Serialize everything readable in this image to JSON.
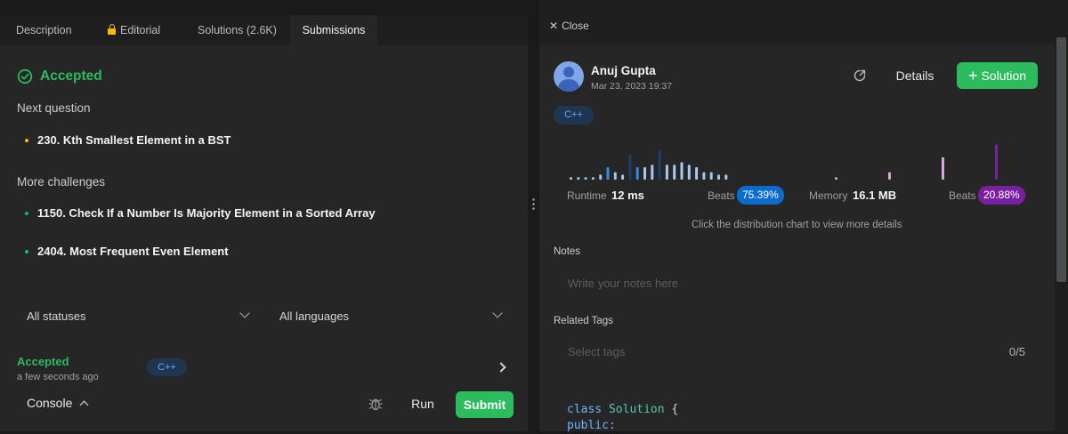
{
  "tabs": {
    "description": "Description",
    "editorial": "Editorial",
    "solutions": "Solutions (2.6K)",
    "submissions": "Submissions"
  },
  "result": {
    "status": "Accepted",
    "next_question_title": "Next question",
    "next_question": "230. Kth Smallest Element in a BST",
    "more_challenges_title": "More challenges",
    "challenges": [
      "1150. Check If a Number Is Majority Element in a Sorted Array",
      "2404. Most Frequent Even Element"
    ]
  },
  "filters": {
    "status": "All statuses",
    "language": "All languages"
  },
  "submission": {
    "status": "Accepted",
    "time": "a few seconds ago",
    "language": "C++"
  },
  "console": {
    "label": "Console",
    "run": "Run",
    "submit": "Submit"
  },
  "detail": {
    "close": "Close",
    "user": "Anuj Gupta",
    "date": "Mar 23, 2023 19:37",
    "details_btn": "Details",
    "solution_btn": "Solution",
    "language": "C++",
    "runtime_label": "Runtime",
    "runtime_value": "12 ms",
    "runtime_beats_label": "Beats",
    "runtime_beats": "75.39%",
    "memory_label": "Memory",
    "memory_value": "16.1 MB",
    "memory_beats_label": "Beats",
    "memory_beats": "20.88%",
    "hint": "Click the distribution chart to view more details",
    "notes_label": "Notes",
    "notes_placeholder": "Write your notes here",
    "tags_label": "Related Tags",
    "tags_placeholder": "Select tags",
    "tags_count": "0/5",
    "code_line1_kw": "class",
    "code_line1_name": "Solution",
    "code_line1_brace": "{",
    "code_line2": "public:"
  },
  "colors": {
    "accent_green": "#2cbb5d",
    "runtime_blue": "#0a6ccf",
    "memory_purple": "#7a1fa2",
    "next_dot": "#ffb800",
    "challenge_dot": "#00b8a3"
  },
  "chart_data": {
    "type": "bar",
    "runtime_distribution": [
      1,
      1,
      1,
      1,
      2,
      5,
      3,
      2,
      10,
      5,
      5,
      6,
      12,
      6,
      6,
      7,
      6,
      5,
      3,
      3,
      2,
      2
    ],
    "memory_distribution": [
      1,
      3,
      9,
      14
    ],
    "runtime_highlight_index": 9,
    "memory_highlight_index": 3
  }
}
